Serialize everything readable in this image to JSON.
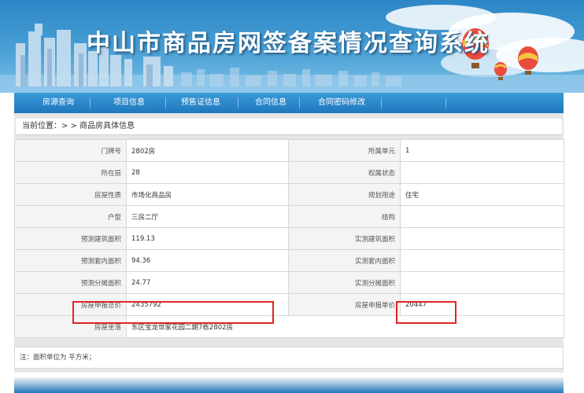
{
  "header": {
    "title": "中山市商品房网签备案情况查询系统"
  },
  "nav": {
    "items": [
      "房源查询",
      "项目信息",
      "预售证信息",
      "合同信息",
      "合同密码修改"
    ]
  },
  "breadcrumb": {
    "label": "当前位置：",
    "path": "> > 商品房具体信息"
  },
  "details": {
    "r0": {
      "l1": "门牌号",
      "v1": "2802房",
      "l2": "所属单元",
      "v2": "1"
    },
    "r1": {
      "l1": "所在层",
      "v1": "28",
      "l2": "权属状态",
      "v2": ""
    },
    "r2": {
      "l1": "房屋性质",
      "v1": "市场化商品房",
      "l2": "规划用途",
      "v2": "住宅"
    },
    "r3": {
      "l1": "户型",
      "v1": "三房二厅",
      "l2": "结构",
      "v2": ""
    },
    "r4": {
      "l1": "预测建筑面积",
      "v1": "119.13",
      "l2": "实测建筑面积",
      "v2": ""
    },
    "r5": {
      "l1": "预测套内面积",
      "v1": "94.36",
      "l2": "实测套内面积",
      "v2": ""
    },
    "r6": {
      "l1": "预测分摊面积",
      "v1": "24.77",
      "l2": "实测分摊面积",
      "v2": ""
    },
    "r7": {
      "l1": "房屋申报总价",
      "v1": "2435792",
      "l2": "房屋申报单价",
      "v2": "20447"
    },
    "r8": {
      "l1": "房屋坐落",
      "v1": "东区宝龙世家花园二期7栋2802房"
    }
  },
  "note": "注：面积单位为 平方米；",
  "colors": {
    "highlight": "#e02424",
    "nav": "#1f78bd",
    "banner": "#2c86c6"
  }
}
